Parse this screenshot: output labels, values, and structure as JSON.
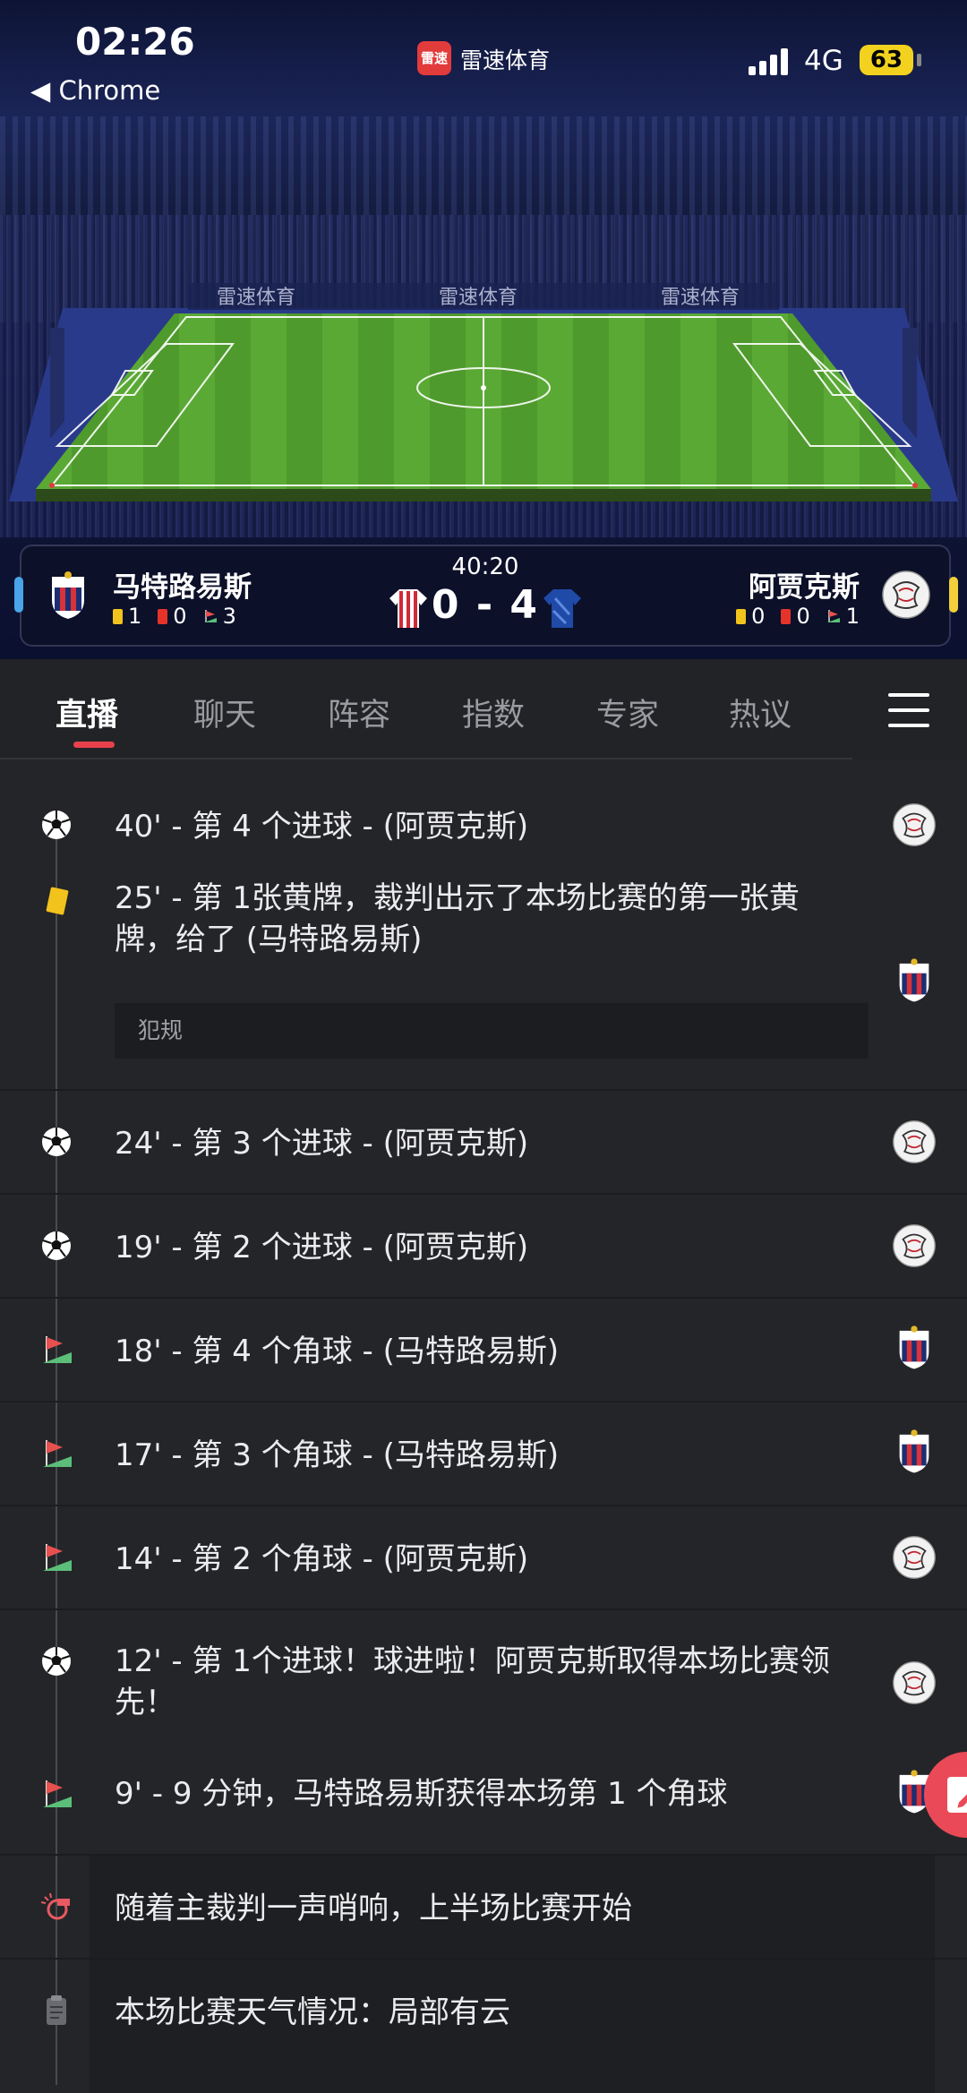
{
  "status_bar": {
    "time": "02:26",
    "back_label": "◀ Chrome",
    "app_logo_text": "雷速",
    "app_name": "雷速体育",
    "network": "4G",
    "battery": "63"
  },
  "stadium": {
    "boards": [
      "雷速体育",
      "雷速体育",
      "雷速体育"
    ],
    "left_board": "雷速体育",
    "right_board": "雷速体育"
  },
  "match": {
    "clock": "40:20",
    "score": "0 - 4",
    "home": {
      "name": "马特路易斯",
      "yellow": "1",
      "red": "0",
      "corners": "3"
    },
    "away": {
      "name": "阿贾克斯",
      "yellow": "0",
      "red": "0",
      "corners": "1"
    },
    "home_color": "#4aa4e8",
    "away_color": "#f3cf3a"
  },
  "tabs": {
    "items": [
      "直播",
      "聊天",
      "阵容",
      "指数",
      "专家",
      "热议"
    ],
    "active": "直播",
    "accent": "#e8414b"
  },
  "events": [
    {
      "icon": "soccer-ball-icon",
      "text": "40' - 第 4 个进球 - (阿贾克斯)",
      "team": "away"
    },
    {
      "icon": "yellow-card-icon",
      "text": "25' - 第 1张黄牌，裁判出示了本场比赛的第一张黄牌，给了 (马特路易斯)",
      "team": "home",
      "note": "犯规"
    },
    {
      "icon": "soccer-ball-icon",
      "text": "24' - 第 3 个进球 - (阿贾克斯)",
      "team": "away"
    },
    {
      "icon": "soccer-ball-icon",
      "text": "19' - 第 2 个进球 - (阿贾克斯)",
      "team": "away"
    },
    {
      "icon": "corner-flag-icon",
      "text": "18' - 第 4 个角球 - (马特路易斯)",
      "team": "home"
    },
    {
      "icon": "corner-flag-icon",
      "text": "17' - 第 3 个角球 - (马特路易斯)",
      "team": "home"
    },
    {
      "icon": "corner-flag-icon",
      "text": "14' - 第 2 个角球 - (阿贾克斯)",
      "team": "away"
    },
    {
      "icon": "soccer-ball-icon",
      "text": "12' - 第 1个进球！球进啦！阿贾克斯取得本场比赛领先！",
      "team": "away"
    },
    {
      "icon": "corner-flag-icon",
      "text": "9' - 9 分钟，马特路易斯获得本场第 1 个角球",
      "team": "home"
    },
    {
      "icon": "whistle-icon",
      "text": "随着主裁判一声哨响，上半场比赛开始"
    },
    {
      "icon": "clipboard-icon",
      "text": "本场比赛天气情况：局部有云"
    }
  ]
}
